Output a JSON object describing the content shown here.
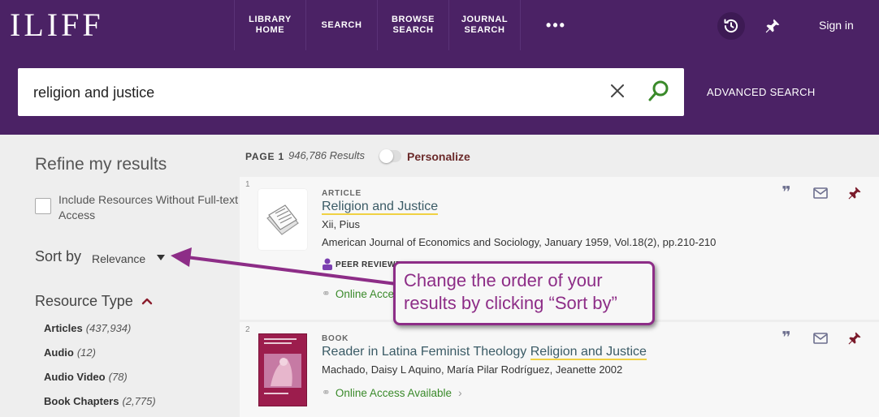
{
  "header": {
    "logo": "ILIFF",
    "nav": [
      {
        "label_line1": "LIBRARY",
        "label_line2": "HOME"
      },
      {
        "label_line1": "SEARCH",
        "label_line2": ""
      },
      {
        "label_line1": "BROWSE",
        "label_line2": "SEARCH"
      },
      {
        "label_line1": "JOURNAL",
        "label_line2": "SEARCH"
      }
    ],
    "more": "•••",
    "history_icon": "history-icon",
    "pin_icon": "pin-icon",
    "sign_in": "Sign in"
  },
  "search": {
    "query": "religion and justice",
    "advanced": "ADVANCED SEARCH"
  },
  "sidebar": {
    "title": "Refine my results",
    "include_label": "Include Resources Without Full-text Access",
    "sort_label": "Sort by",
    "sort_value": "Relevance",
    "resource_type_title": "Resource Type",
    "resource_types": [
      {
        "name": "Articles",
        "count": "(437,934)"
      },
      {
        "name": "Audio",
        "count": "(12)"
      },
      {
        "name": "Audio Video",
        "count": "(78)"
      },
      {
        "name": "Book Chapters",
        "count": "(2,775)"
      }
    ]
  },
  "results_header": {
    "page": "PAGE 1",
    "count": "946,786 Results",
    "personalize": "Personalize"
  },
  "results": [
    {
      "index": "1",
      "type": "ARTICLE",
      "title_plain": "",
      "title_highlight": "Religion and Justice",
      "author": "Xii, Pius",
      "source": "American Journal of Economics and Sociology, January 1959, Vol.18(2), pp.210-210",
      "badge": "PEER REVIEWED",
      "access": "Online Access Available"
    },
    {
      "index": "2",
      "type": "BOOK",
      "title_plain": "Reader in Latina Feminist Theology ",
      "title_highlight": "Religion and Justice",
      "author": "Machado, Daisy L Aquino, María Pilar Rodríguez, Jeanette 2002",
      "access": "Online Access Available"
    }
  ],
  "annotation": {
    "line1": "Change the order of your",
    "line2": "results by clicking “Sort by”"
  },
  "colors": {
    "brand": "#4b2265",
    "title_link": "#3b5b66",
    "access_green": "#3a8a2a",
    "annotation": "#8d2d87",
    "highlight": "#f0d143"
  }
}
